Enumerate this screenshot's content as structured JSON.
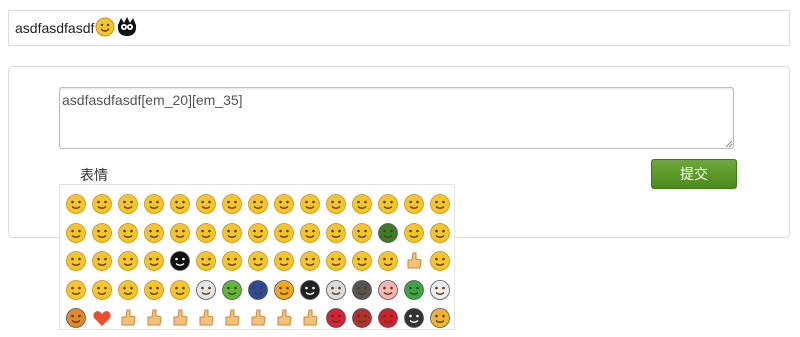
{
  "preview": {
    "text": "asdfasdfasdf",
    "emojis": [
      "smile-face",
      "black-ghost-face"
    ]
  },
  "form": {
    "textarea_value": "asdfasdfasdf[em_20][em_35]",
    "emoji_label": "表情",
    "submit_label": "提交"
  },
  "colors": {
    "accent_button": "#5a9a28",
    "face_yellow": "#f5c52c",
    "border": "#dddddd"
  },
  "emoji_picker": {
    "columns": 15,
    "items": [
      "smile",
      "cry",
      "heart-eyes",
      "dizzy",
      "crying",
      "shy",
      "pout",
      "sly",
      "sweat",
      "angry",
      "furious",
      "grin",
      "laugh",
      "pinched",
      "sad",
      "embarrassed",
      "squint-laugh",
      "worried",
      "thinking",
      "smirk",
      "surprised",
      "blush",
      "smug",
      "frown",
      "mad",
      "bored",
      "big-grin",
      "turtle-face",
      "ninja",
      "puzzled",
      "scared",
      "startled",
      "dizzy-eyes",
      "blurred",
      "black-ghost",
      "shocked",
      "drool",
      "tongue",
      "wink",
      "whisper",
      "smile2",
      "disappointed",
      "yawn",
      "clap",
      "blush2",
      "sleepy",
      "blank",
      "nerdy",
      "cool",
      "rage",
      "skull",
      "green-man",
      "moon",
      "sun",
      "bomb",
      "skull2",
      "knife",
      "pig",
      "watermelon",
      "coffee",
      "rice-bowl",
      "heart",
      "thumbs-up",
      "thumbs-down",
      "handshake",
      "victory",
      "fist",
      "ok-hand",
      "ok-hand2",
      "point",
      "rose",
      "wilted-rose",
      "lips",
      "penguins",
      "bee"
    ]
  }
}
